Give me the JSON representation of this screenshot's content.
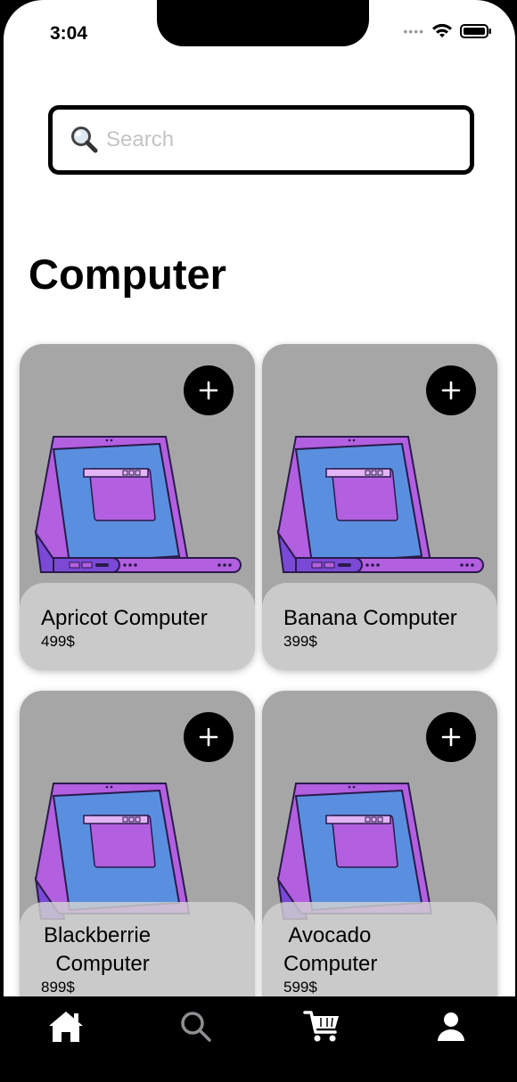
{
  "status": {
    "time": "3:04",
    "signal_icon": "signal-dots-icon",
    "wifi_icon": "wifi-icon",
    "battery_icon": "battery-icon"
  },
  "search": {
    "placeholder": "Search",
    "value": "",
    "icon": "search-icon"
  },
  "page": {
    "title": "Computer"
  },
  "products": [
    {
      "name": "Apricot Computer",
      "price": "499$"
    },
    {
      "name": "Banana Computer",
      "price": "399$"
    },
    {
      "name": "Blackberrie\n  Computer",
      "price": "899$"
    },
    {
      "name": " Avocado\nComputer",
      "price": "599$"
    }
  ],
  "tabbar": {
    "items": [
      "home-icon",
      "search-icon",
      "cart-icon",
      "profile-icon"
    ]
  },
  "colors": {
    "card": "#a6a6a6",
    "laptop_body": "#b25fe0",
    "laptop_screen": "#5a8fe0",
    "laptop_side": "#7a49d6"
  }
}
